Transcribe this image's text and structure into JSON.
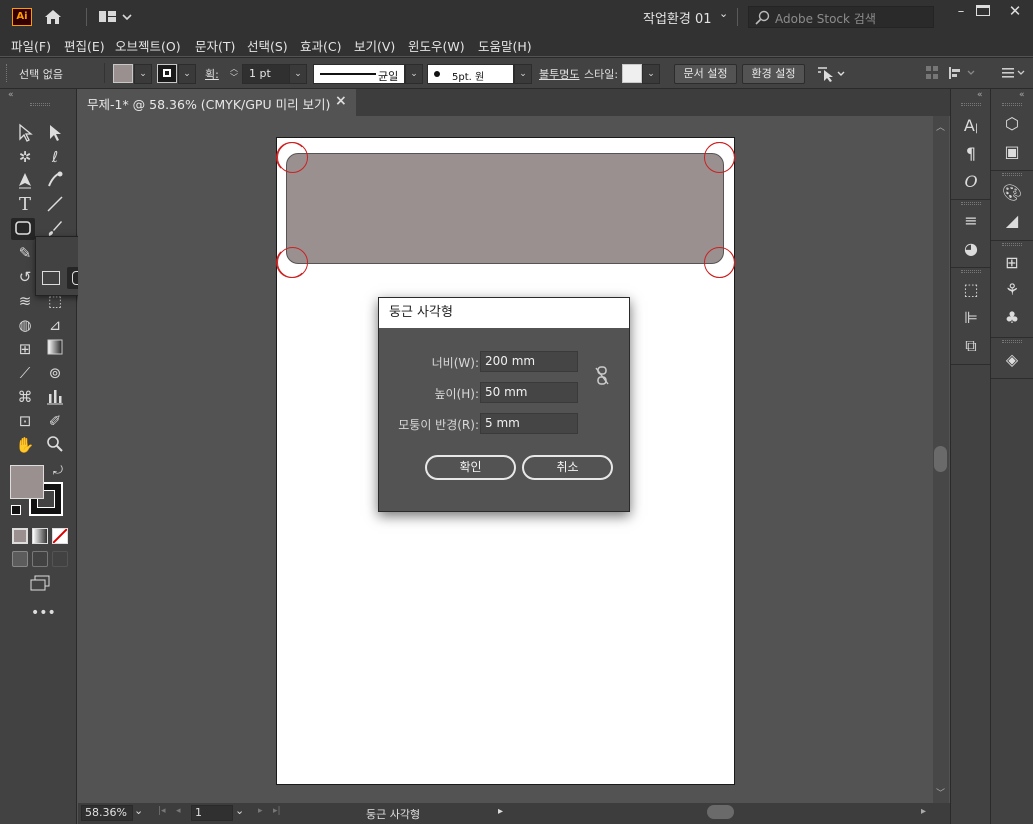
{
  "app": {
    "logo": "Ai",
    "workspace": "작업환경 01",
    "search_placeholder": "Adobe Stock 검색",
    "colors": {
      "logo_bg": "#330000",
      "logo_fg": "#ff9a00",
      "accent_red": "#cc2020"
    }
  },
  "menu": [
    "파일(F)",
    "편집(E)",
    "오브젝트(O)",
    "문자(T)",
    "선택(S)",
    "효과(C)",
    "보기(V)",
    "윈도우(W)",
    "도움말(H)"
  ],
  "control": {
    "selection_label": "선택 없음",
    "stroke_label": "획:",
    "stroke_value": "1 pt",
    "profile_label": "균일",
    "brush_label": "5pt. 원",
    "opacity_label": "불투명도",
    "style_label": "스타일:",
    "doc_setup": "문서 설정",
    "preferences": "환경 설정"
  },
  "document": {
    "tab_title": "무제-1* @ 58.36% (CMYK/GPU 미리 보기)",
    "close": "×",
    "fill_color": "#9b9090"
  },
  "dialog": {
    "title": "둥근 사각형",
    "width_label": "너비(W):",
    "width_value": "200 mm",
    "height_label": "높이(H):",
    "height_value": "50 mm",
    "radius_label": "모퉁이 반경(R):",
    "radius_value": "5 mm",
    "ok": "확인",
    "cancel": "취소"
  },
  "status": {
    "zoom": "58.36%",
    "artboard": "1",
    "tool": "둥근 사각형"
  }
}
